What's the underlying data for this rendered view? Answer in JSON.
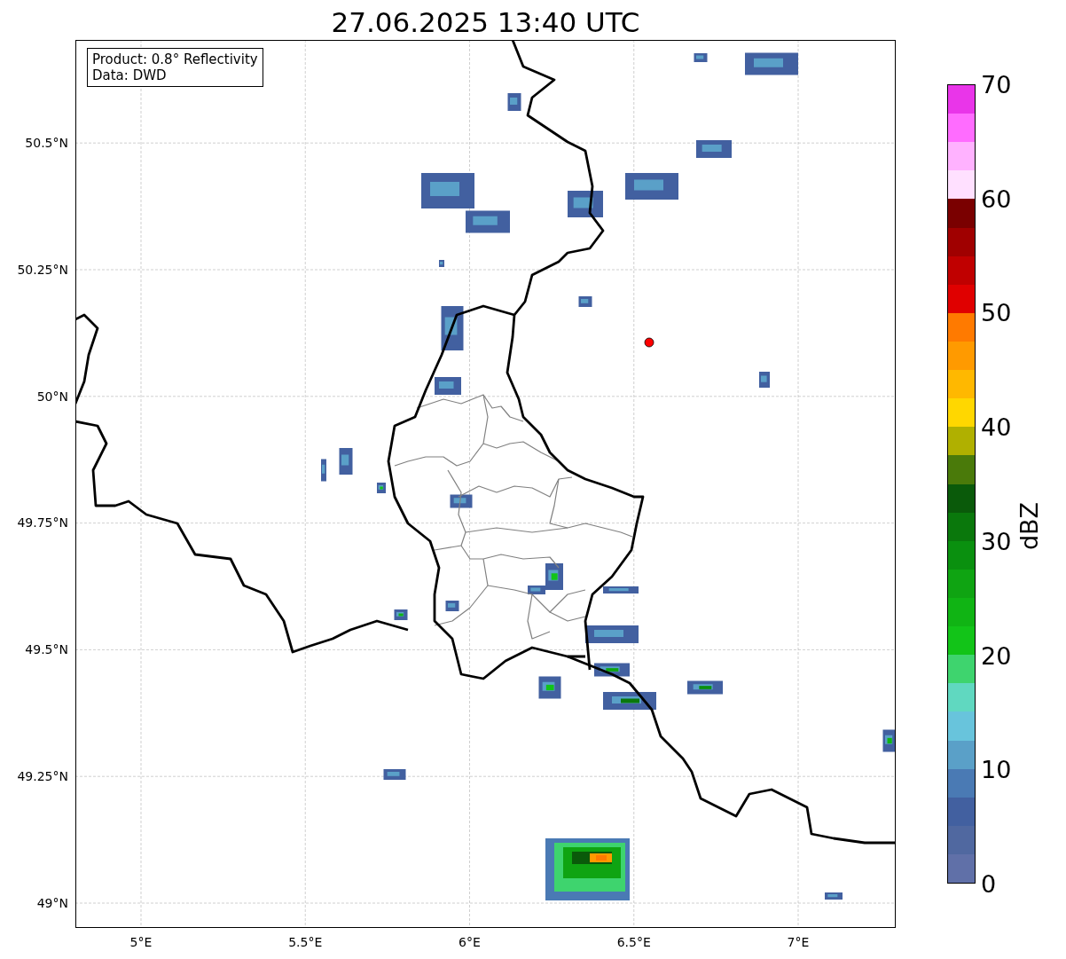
{
  "title": "27.06.2025 13:40 UTC",
  "info_box": [
    "Product: 0.8° Reflectivity",
    "Data: DWD"
  ],
  "x_ticks": [
    "5°E",
    "5.5°E",
    "6°E",
    "6.5°E",
    "7°E"
  ],
  "y_ticks": [
    "50.5°N",
    "50.25°N",
    "50°N",
    "49.75°N",
    "49.5°N",
    "49.25°N",
    "49°N"
  ],
  "colorbar": {
    "label": "dBZ",
    "ticks": [
      "70",
      "60",
      "50",
      "40",
      "30",
      "20",
      "10",
      "0"
    ],
    "segments": [
      {
        "color": "#6070a8"
      },
      {
        "color": "#5068a0"
      },
      {
        "color": "#4260a0"
      },
      {
        "color": "#4a7ab4"
      },
      {
        "color": "#5aa0c8"
      },
      {
        "color": "#68c4dc"
      },
      {
        "color": "#60d8c0"
      },
      {
        "color": "#3ed46e"
      },
      {
        "color": "#12c418"
      },
      {
        "color": "#10b414"
      },
      {
        "color": "#0fa412"
      },
      {
        "color": "#0a900f"
      },
      {
        "color": "#0a780c"
      },
      {
        "color": "#0a5a0a"
      },
      {
        "color": "#4a7a0a"
      },
      {
        "color": "#b0b000"
      },
      {
        "color": "#ffd700"
      },
      {
        "color": "#ffb800"
      },
      {
        "color": "#ff9a00"
      },
      {
        "color": "#ff7a00"
      },
      {
        "color": "#e00000"
      },
      {
        "color": "#c00000"
      },
      {
        "color": "#a00000"
      },
      {
        "color": "#7a0000"
      },
      {
        "color": "#ffe0ff"
      },
      {
        "color": "#ffb2ff"
      },
      {
        "color": "#ff6cff"
      },
      {
        "color": "#e935e9"
      }
    ]
  }
}
